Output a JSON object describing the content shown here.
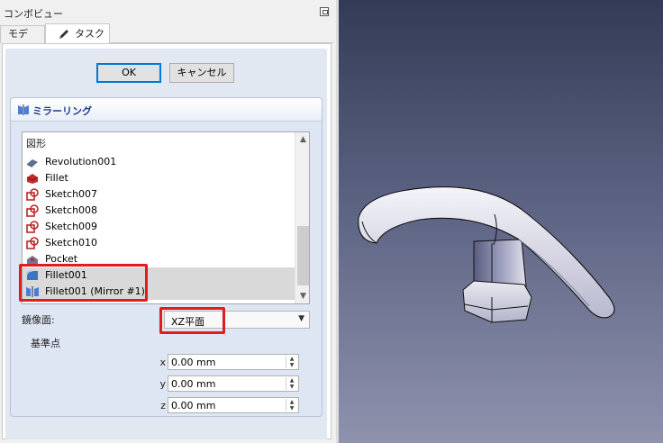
{
  "combo": {
    "title": "コンボビュー",
    "tabs": [
      {
        "label": "モデル"
      },
      {
        "label": "タスク"
      }
    ]
  },
  "buttons": {
    "ok": "OK",
    "cancel": "キャンセル"
  },
  "mirror": {
    "title": "ミラーリング",
    "list_header": "図形",
    "items": [
      {
        "label": "Revolution001",
        "icon": "revolution-icon"
      },
      {
        "label": "Fillet",
        "icon": "fillet-icon"
      },
      {
        "label": "Sketch007",
        "icon": "sketch-icon"
      },
      {
        "label": "Sketch008",
        "icon": "sketch-icon"
      },
      {
        "label": "Sketch009",
        "icon": "sketch-icon"
      },
      {
        "label": "Sketch010",
        "icon": "sketch-icon"
      },
      {
        "label": "Pocket",
        "icon": "pocket-icon"
      },
      {
        "label": "Fillet001",
        "icon": "fillet-icon"
      },
      {
        "label": "Fillet001 (Mirror #1)",
        "icon": "mirror-icon"
      }
    ],
    "plane_label": "鏡像面:",
    "plane_value": "XZ平面",
    "base_point": {
      "title": "基準点",
      "x": {
        "axis": "x",
        "value": "0.00 mm"
      },
      "y": {
        "axis": "y",
        "value": "0.00 mm"
      },
      "z": {
        "axis": "z",
        "value": "0.00 mm"
      }
    }
  },
  "colors": {
    "highlight": "#e21b1b",
    "view_top": "#343b56",
    "view_bottom": "#8e92ad"
  }
}
